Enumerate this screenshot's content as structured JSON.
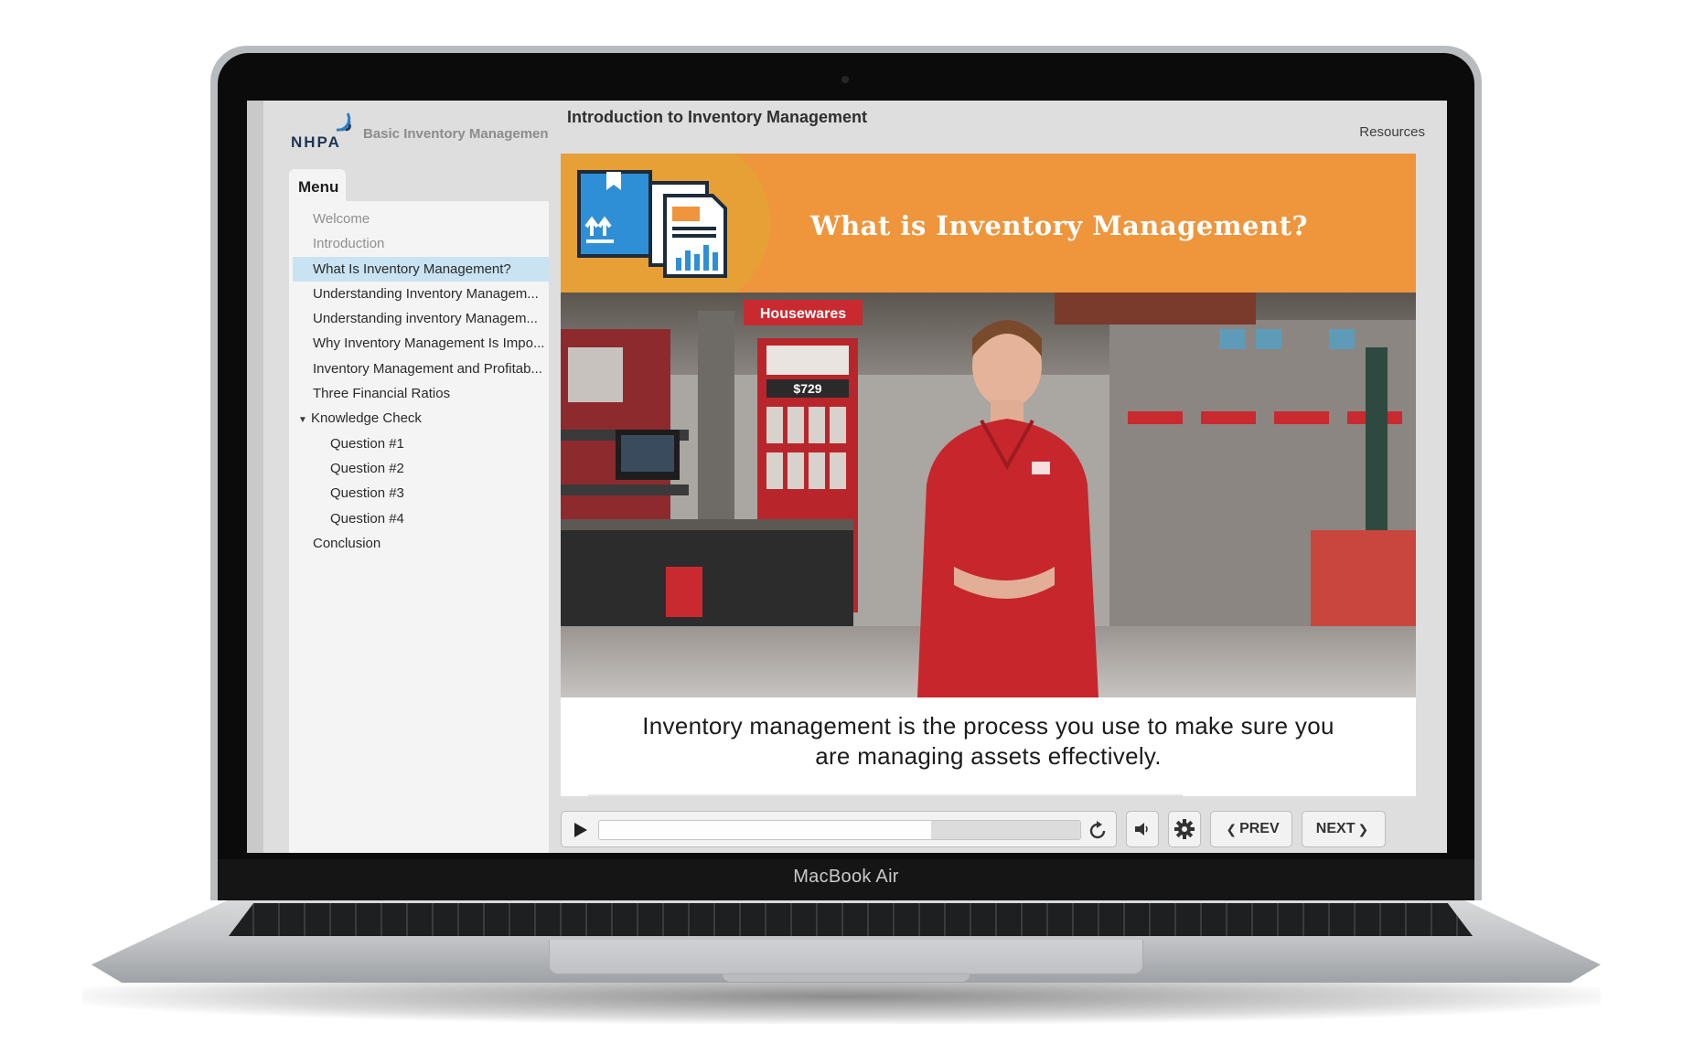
{
  "device": {
    "brand_label": "MacBook Air"
  },
  "sidebar": {
    "logo_text": "NHPA",
    "course_title": "Basic Inventory Management",
    "menu_tab_label": "Menu",
    "items": [
      {
        "label": "Welcome",
        "state": "visited"
      },
      {
        "label": "Introduction",
        "state": "visited"
      },
      {
        "label": "What Is Inventory Management?",
        "state": "active"
      },
      {
        "label": "Understanding Inventory Managem...",
        "state": "normal"
      },
      {
        "label": "Understanding inventory Managem...",
        "state": "normal"
      },
      {
        "label": "Why Inventory Management Is Impo...",
        "state": "normal"
      },
      {
        "label": "Inventory Management and Profitab...",
        "state": "normal"
      },
      {
        "label": "Three Financial Ratios",
        "state": "normal"
      }
    ],
    "group": {
      "label": "Knowledge Check",
      "children": [
        {
          "label": "Question #1"
        },
        {
          "label": "Question #2"
        },
        {
          "label": "Question #3"
        },
        {
          "label": "Question #4"
        }
      ]
    },
    "last_item": {
      "label": "Conclusion"
    }
  },
  "header": {
    "lesson_title": "Introduction to Inventory Management",
    "resources_label": "Resources"
  },
  "slide": {
    "banner_title": "What is Inventory Management?",
    "photo_store_sign": "Housewares",
    "photo_price_tag": "$729",
    "caption_line1": "Inventory management is the process you use to make sure you",
    "caption_line2": "are managing assets effectively."
  },
  "player": {
    "progress_fraction": 0.69,
    "prev_label": "PREV",
    "next_label": "NEXT",
    "icons": [
      "play-icon",
      "replay-icon",
      "volume-icon",
      "gear-icon",
      "chevron-left-icon",
      "chevron-right-icon"
    ]
  },
  "colors": {
    "banner_orange": "#ef953c",
    "active_item": "#c9e3f2",
    "shirt_red": "#c7262c"
  }
}
